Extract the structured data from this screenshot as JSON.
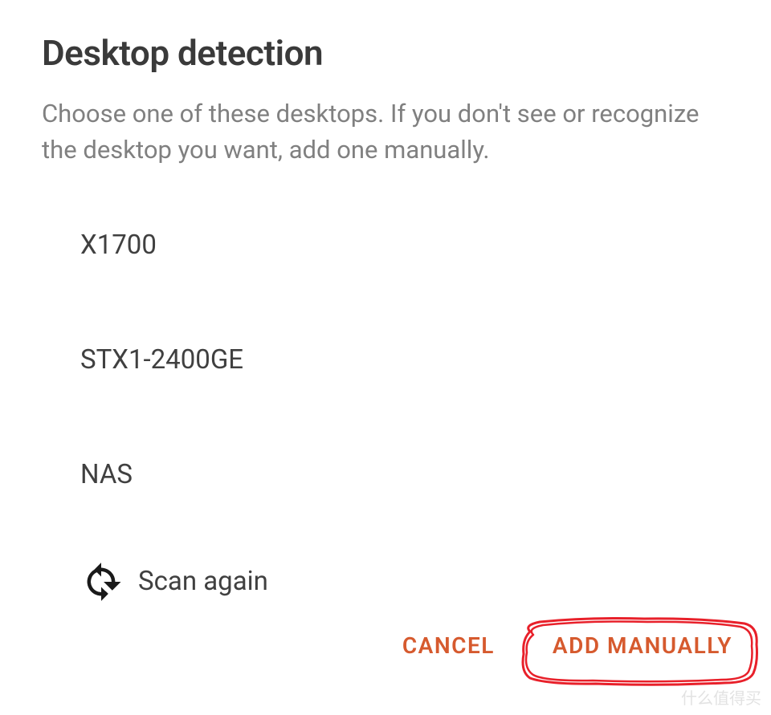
{
  "dialog": {
    "title": "Desktop detection",
    "description": "Choose one of these desktops. If you don't see or recognize the desktop you want, add one manually."
  },
  "desktops": [
    {
      "name": "X1700"
    },
    {
      "name": "STX1-2400GE"
    },
    {
      "name": "NAS"
    }
  ],
  "scan_again_label": "Scan again",
  "actions": {
    "cancel": "CANCEL",
    "add_manually": "ADD MANUALLY"
  },
  "watermark": "什么值得买"
}
